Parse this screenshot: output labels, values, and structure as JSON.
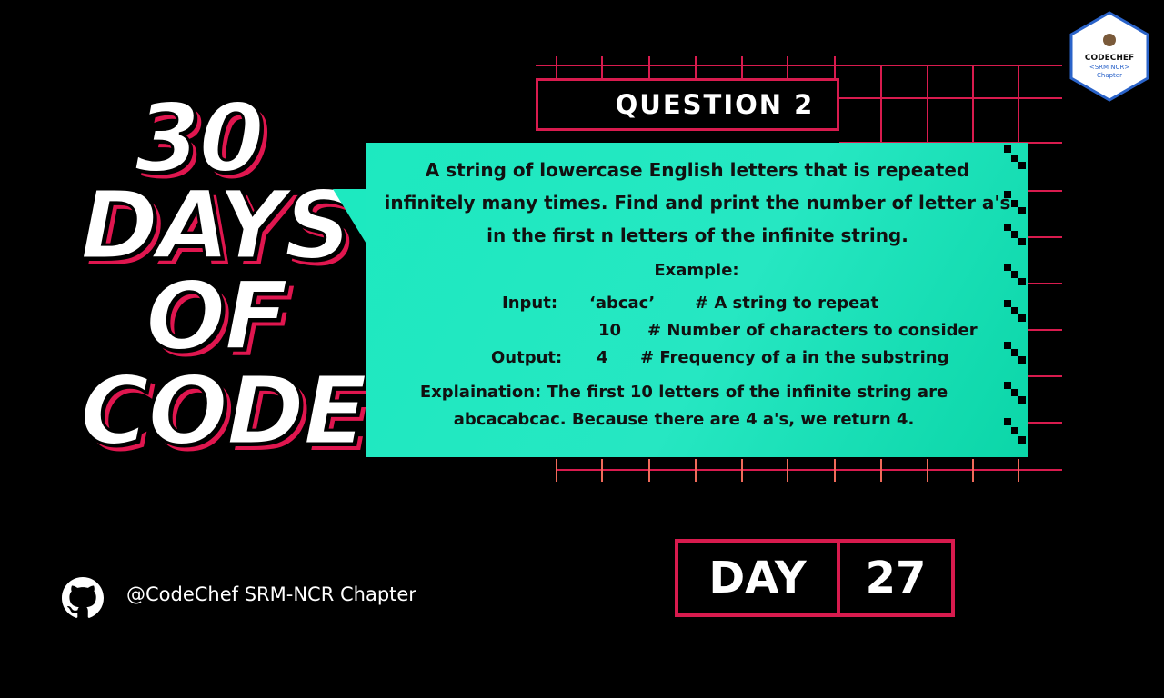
{
  "title": {
    "line1": "30",
    "line2": "DAYS",
    "line3": "OF",
    "line4": "CODE"
  },
  "question_label": "QUESTION  2",
  "problem": {
    "prompt": "A string of lowercase English letters that is repeated infinitely many times. Find and print the number of letter a's in the first n letters of the infinite string.",
    "example_label": "Example:",
    "input_label": "Input:",
    "input_value1": "‘abcac’",
    "input_comment1": "# A string to repeat",
    "input_value2": "10",
    "input_comment2": "# Number of characters to consider",
    "output_label": "Output:",
    "output_value": "4",
    "output_comment": "# Frequency of a in the substring",
    "explanation": "Explaination: The first 10 letters of the infinite string are abcacabcac. Because there are 4 a's, we return 4."
  },
  "day": {
    "label": "DAY",
    "number": "27"
  },
  "footer": {
    "handle": "@CodeChef SRM-NCR Chapter",
    "icon": "github-icon"
  },
  "badge": {
    "line1": "CODECHEF",
    "line2": "<SRM NCR>",
    "line3": "Chapter"
  },
  "colors": {
    "background": "#000000",
    "accent": "#d81b4e",
    "panel": "#1de9c0"
  }
}
